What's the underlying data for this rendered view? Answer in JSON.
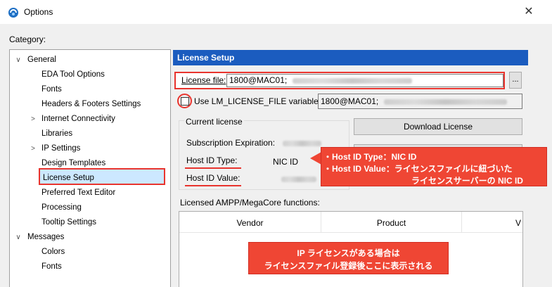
{
  "window": {
    "title": "Options",
    "close_glyph": "✕",
    "icon": "app-icon"
  },
  "category_label": "Category:",
  "tree": {
    "items": [
      {
        "label": "General",
        "expand": "∨"
      },
      {
        "label": "EDA Tool Options"
      },
      {
        "label": "Fonts"
      },
      {
        "label": "Headers & Footers Settings"
      },
      {
        "label": "Internet Connectivity",
        "expand": ">"
      },
      {
        "label": "Libraries"
      },
      {
        "label": "IP Settings",
        "expand": ">"
      },
      {
        "label": "Design Templates"
      },
      {
        "label": "License Setup",
        "selected": true
      },
      {
        "label": "Preferred Text Editor"
      },
      {
        "label": "Processing"
      },
      {
        "label": "Tooltip Settings"
      },
      {
        "label": "Messages",
        "expand": "∨"
      },
      {
        "label": "Colors"
      },
      {
        "label": "Fonts"
      }
    ]
  },
  "panel": {
    "header": "License Setup",
    "license_file_label": "License file:",
    "license_file_value": "1800@MAC01;",
    "browse_label": "...",
    "use_lm_label": "Use LM_LICENSE_FILE variable:",
    "lm_value": "1800@MAC01;",
    "current_license": {
      "title": "Current license",
      "subscription_label": "Subscription Expiration:",
      "host_id_type_label": "Host ID Type:",
      "host_id_type_value": "NIC ID",
      "host_id_value_label": "Host ID Value:"
    },
    "download_button": "Download License",
    "ampp_label": "Licensed AMPP/MegaCore functions:",
    "ampp_columns": [
      "Vendor",
      "Product",
      "V"
    ]
  },
  "callout": {
    "line1": "・Host ID Type：NIC ID",
    "line2": "・Host ID Value：ライセンスファイルに紐づいた",
    "line3": "ライセンスサーバーの NIC ID"
  },
  "ampp_callout": {
    "line1": "IP ライセンスがある場合は",
    "line2": "ライセンスファイル登録後ここに表示される"
  },
  "colors": {
    "accent_red": "#e8342e",
    "header_blue": "#1b5cbf",
    "selection": "#cce8ff"
  }
}
